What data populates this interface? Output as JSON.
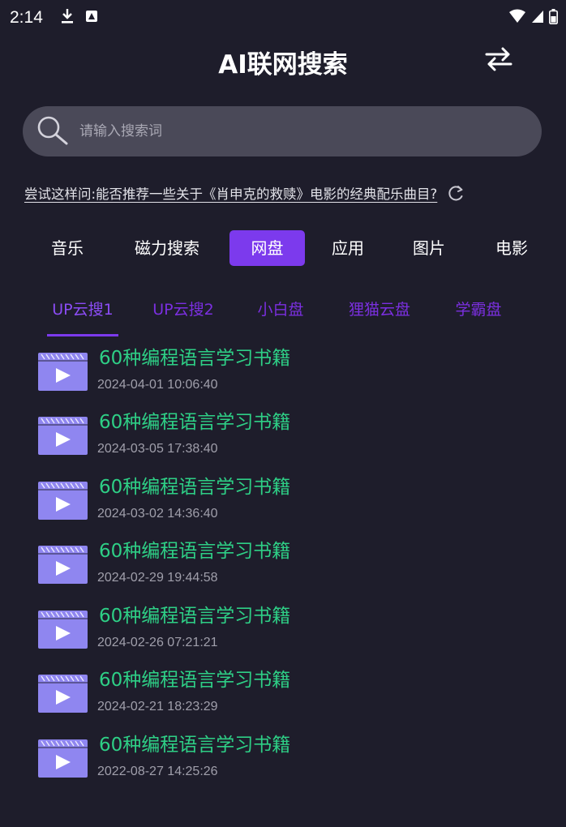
{
  "status_bar": {
    "time": "2:14"
  },
  "header": {
    "title": "AI联网搜索"
  },
  "search": {
    "placeholder": "请输入搜索词",
    "value": ""
  },
  "suggestion": {
    "text": "尝试这样问:能否推荐一些关于《肖申克的救赎》电影的经典配乐曲目?"
  },
  "category_tabs": [
    {
      "label": "音乐",
      "active": false
    },
    {
      "label": "磁力搜索",
      "active": false
    },
    {
      "label": "网盘",
      "active": true
    },
    {
      "label": "应用",
      "active": false
    },
    {
      "label": "图片",
      "active": false
    },
    {
      "label": "电影",
      "active": false
    }
  ],
  "source_tabs": [
    {
      "label": "UP云搜1",
      "active": true
    },
    {
      "label": "UP云搜2",
      "active": false
    },
    {
      "label": "小白盘",
      "active": false
    },
    {
      "label": "狸猫云盘",
      "active": false
    },
    {
      "label": "学霸盘",
      "active": false
    }
  ],
  "results": [
    {
      "title": "60种编程语言学习书籍",
      "time": "2024-04-01 10:06:40"
    },
    {
      "title": "60种编程语言学习书籍",
      "time": "2024-03-05 17:38:40"
    },
    {
      "title": "60种编程语言学习书籍",
      "time": "2024-03-02 14:36:40"
    },
    {
      "title": "60种编程语言学习书籍",
      "time": "2024-02-29 19:44:58"
    },
    {
      "title": "60种编程语言学习书籍",
      "time": "2024-02-26 07:21:21"
    },
    {
      "title": "60种编程语言学习书籍",
      "time": "2024-02-21 18:23:29"
    },
    {
      "title": "60种编程语言学习书籍",
      "time": "2022-08-27 14:25:26"
    }
  ],
  "colors": {
    "background": "#1e1d2b",
    "accent": "#7c3aed",
    "result_title": "#2ecf86",
    "thumbnail": "#8f86f0"
  },
  "icons": {
    "download": "download-icon",
    "notification": "app-notification-icon",
    "wifi": "wifi-icon",
    "signal": "signal-icon",
    "battery": "battery-icon",
    "swap": "swap-arrows-icon",
    "search": "search-icon",
    "refresh": "refresh-icon",
    "thumbnail": "video-thumbnail-icon"
  }
}
